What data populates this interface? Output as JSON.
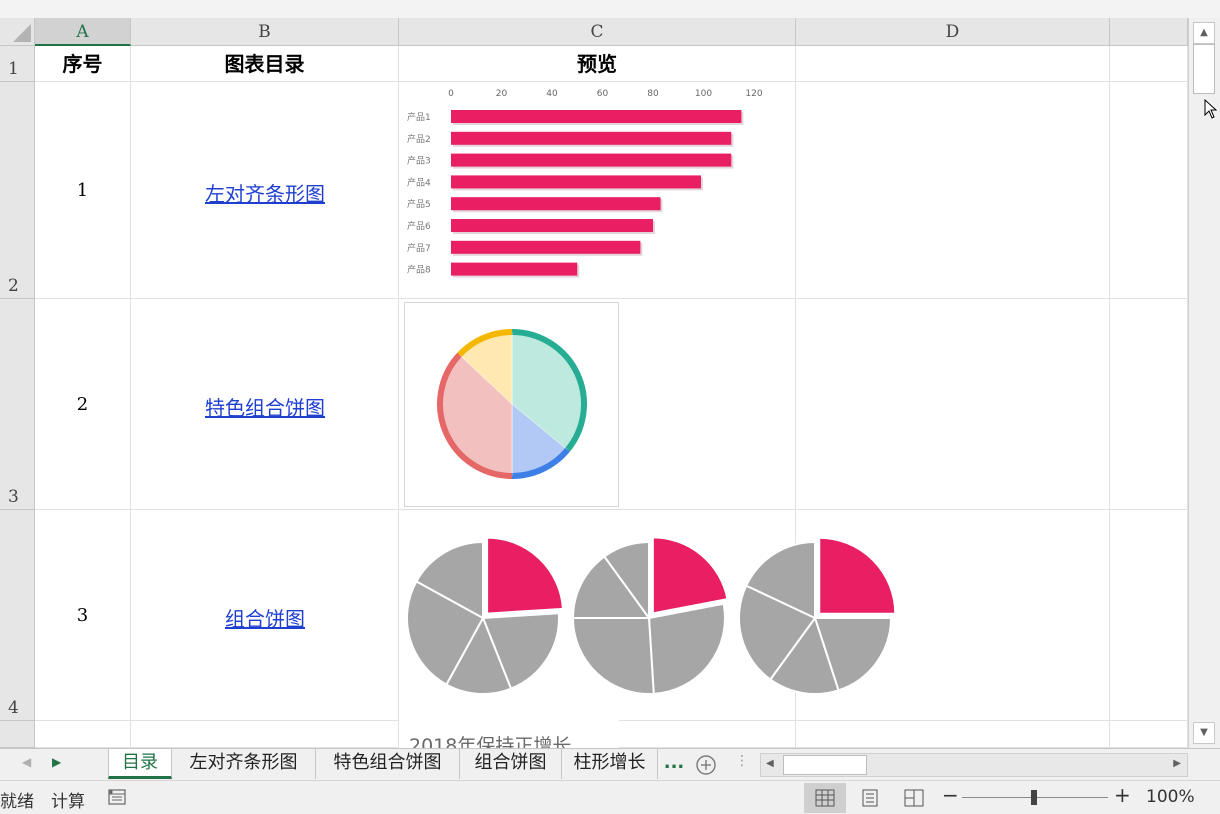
{
  "columns": [
    "A",
    "B",
    "C",
    "D"
  ],
  "rows": [
    "1",
    "2",
    "3",
    "4"
  ],
  "header_row": {
    "a": "序号",
    "b": "图表目录",
    "c": "预览"
  },
  "items": [
    {
      "num": "1",
      "link": "左对齐条形图"
    },
    {
      "num": "2",
      "link": "特色组合饼图"
    },
    {
      "num": "3",
      "link": "组合饼图"
    }
  ],
  "partial_text": "2018年保持正增长",
  "sheet_tabs": [
    "目录",
    "左对齐条形图",
    "特色组合饼图",
    "组合饼图",
    "柱形增长"
  ],
  "tabs_more": "...",
  "status": {
    "ready": "就绪",
    "calc": "计算",
    "zoom": "100%"
  },
  "colors": {
    "accent": "#217346",
    "bar": "#e91e63",
    "gray_slice": "#a6a6a6",
    "link": "#1f3fd1"
  },
  "chart_data": [
    {
      "type": "bar",
      "orientation": "horizontal",
      "categories": [
        "产品1",
        "产品2",
        "产品3",
        "产品4",
        "产品5",
        "产品6",
        "产品7",
        "产品8"
      ],
      "values": [
        115,
        111,
        111,
        99,
        83,
        80,
        75,
        50
      ],
      "xticks": [
        "0",
        "20",
        "40",
        "60",
        "80",
        "100",
        "120"
      ],
      "xlim": [
        0,
        120
      ],
      "color": "#e91e63"
    },
    {
      "type": "pie",
      "series": [
        {
          "values": [
            36,
            14,
            37,
            13
          ],
          "colors": [
            "#bde9df",
            "#b3c9f5",
            "#f3c0c0",
            "#ffe9b0"
          ],
          "ring_colors": [
            "#26ad94",
            "#3d7fe6",
            "#e56767",
            "#f5b800"
          ]
        }
      ]
    },
    {
      "type": "pie",
      "series": [
        {
          "values": [
            24,
            20,
            14,
            25,
            17
          ],
          "highlight_index": 0
        },
        {
          "values": [
            22,
            27,
            26,
            15,
            10
          ],
          "highlight_index": 0
        },
        {
          "values": [
            25,
            20,
            15,
            22,
            18
          ],
          "highlight_index": 0
        }
      ]
    }
  ]
}
